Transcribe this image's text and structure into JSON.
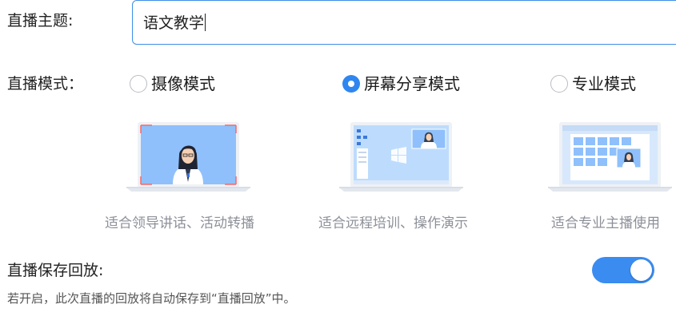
{
  "topic": {
    "label": "直播主题:",
    "value": "语文教学"
  },
  "mode": {
    "label": "直播模式：",
    "options": [
      {
        "label": "摄像模式",
        "caption": "适合领导讲话、活动转播",
        "selected": false,
        "icon": "camera-mode-illustration"
      },
      {
        "label": "屏幕分享模式",
        "caption": "适合远程培训、操作演示",
        "selected": true,
        "icon": "screen-share-illustration"
      },
      {
        "label": "专业模式",
        "caption": "适合专业主播使用",
        "selected": false,
        "icon": "pro-mode-illustration"
      }
    ]
  },
  "replay": {
    "label": "直播保存回放:",
    "description": "若开启，此次直播的回放将自动保存到“直播回放”中。",
    "enabled": true
  },
  "colors": {
    "accent": "#2f86f0",
    "caption_text": "#8d9099",
    "illustration_screen": "#8fc0fb"
  }
}
